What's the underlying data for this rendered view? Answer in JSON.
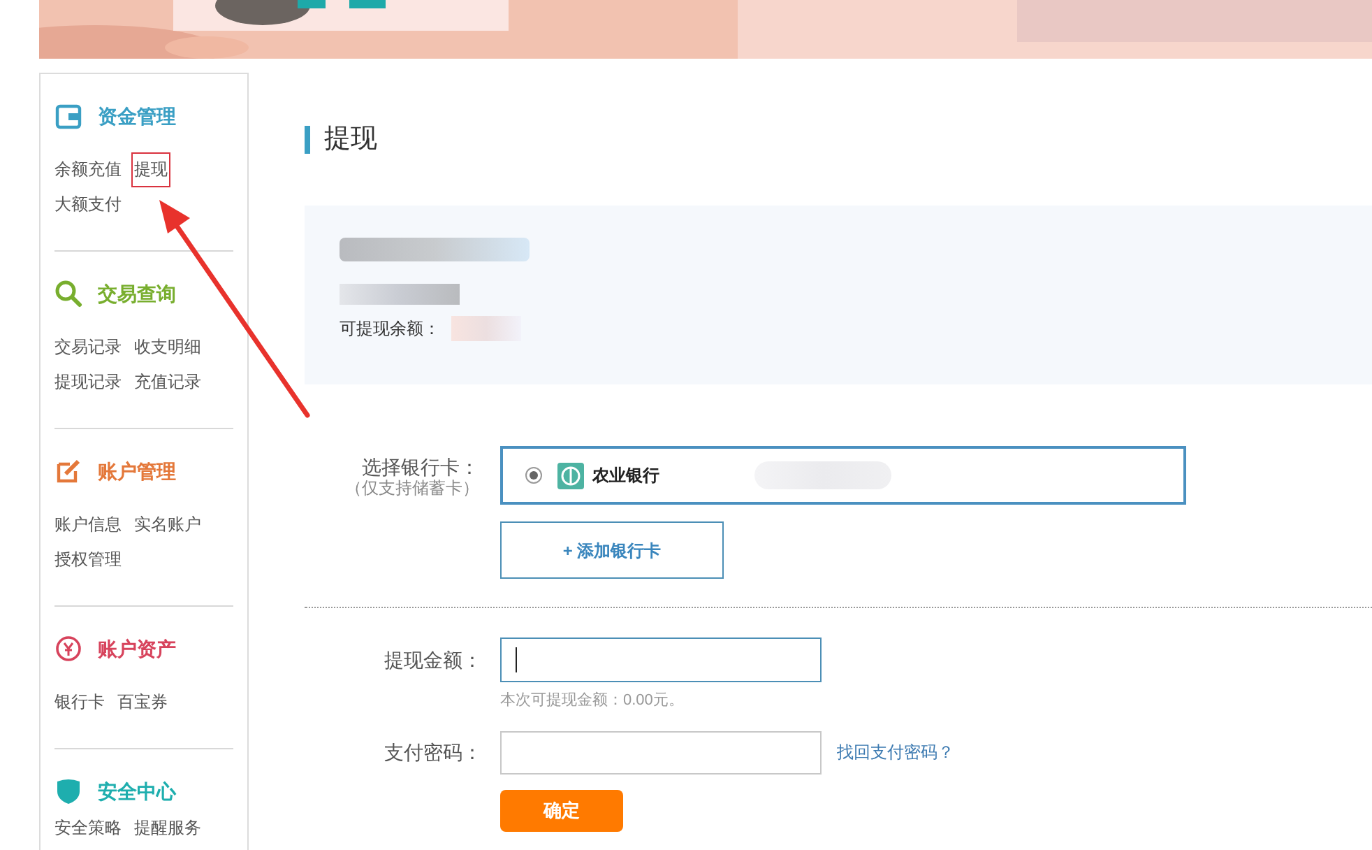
{
  "sidebar": {
    "sections": [
      {
        "title": "资金管理",
        "color": "#3a9fc4",
        "rows": [
          [
            {
              "label": "余额充值",
              "annotated": false
            },
            {
              "label": "提现",
              "annotated": true
            }
          ],
          [
            {
              "label": "大额支付",
              "annotated": false
            }
          ]
        ]
      },
      {
        "title": "交易查询",
        "color": "#78ae2e",
        "rows": [
          [
            {
              "label": "交易记录",
              "annotated": false
            },
            {
              "label": "收支明细",
              "annotated": false
            }
          ],
          [
            {
              "label": "提现记录",
              "annotated": false
            },
            {
              "label": "充值记录",
              "annotated": false
            }
          ]
        ]
      },
      {
        "title": "账户管理",
        "color": "#e4783a",
        "rows": [
          [
            {
              "label": "账户信息",
              "annotated": false
            },
            {
              "label": "实名账户",
              "annotated": false
            }
          ],
          [
            {
              "label": "授权管理",
              "annotated": false
            }
          ]
        ]
      },
      {
        "title": "账户资产",
        "color": "#d7435c",
        "rows": [
          [
            {
              "label": "银行卡",
              "annotated": false
            },
            {
              "label": "百宝券",
              "annotated": false
            }
          ]
        ]
      },
      {
        "title": "安全中心",
        "color": "#1eaeae",
        "rows": [
          [
            {
              "label": "安全策略",
              "annotated": false
            },
            {
              "label": "提醒服务",
              "annotated": false
            }
          ]
        ]
      }
    ]
  },
  "page_title": "提现",
  "info": {
    "balance_label": "可提现余额："
  },
  "bank": {
    "label": "选择银行卡：",
    "note": "（仅支持储蓄卡）",
    "cards": [
      {
        "name": "农业银行",
        "selected": true
      }
    ],
    "add_button": "+ 添加银行卡"
  },
  "amount": {
    "label": "提现金额：",
    "hint": "本次可提现金额：0.00元。"
  },
  "password": {
    "label": "支付密码：",
    "link": "找回支付密码？"
  },
  "submit": "确定"
}
